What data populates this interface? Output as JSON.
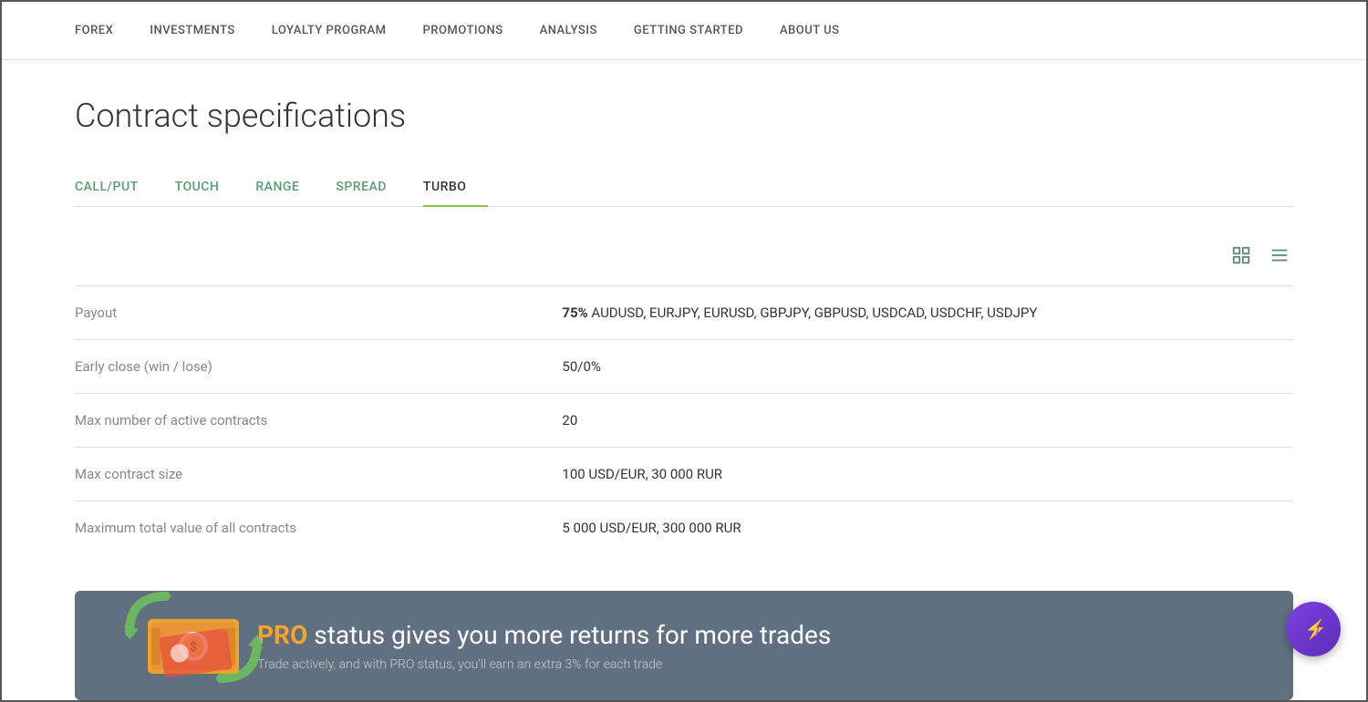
{
  "nav": {
    "items": [
      {
        "label": "FOREX",
        "id": "forex"
      },
      {
        "label": "INVESTMENTS",
        "id": "investments"
      },
      {
        "label": "LOYALTY PROGRAM",
        "id": "loyalty-program"
      },
      {
        "label": "PROMOTIONS",
        "id": "promotions"
      },
      {
        "label": "ANALYSIS",
        "id": "analysis"
      },
      {
        "label": "GETTING STARTED",
        "id": "getting-started"
      },
      {
        "label": "ABOUT US",
        "id": "about-us"
      }
    ]
  },
  "page": {
    "title": "Contract specifications"
  },
  "tabs": [
    {
      "label": "CALL/PUT",
      "id": "call-put",
      "active": false
    },
    {
      "label": "TOUCH",
      "id": "touch",
      "active": false
    },
    {
      "label": "RANGE",
      "id": "range",
      "active": false
    },
    {
      "label": "SPREAD",
      "id": "spread",
      "active": false
    },
    {
      "label": "TURBO",
      "id": "turbo",
      "active": true
    }
  ],
  "specs": [
    {
      "label": "Payout",
      "value": "75% AUDUSD, EURJPY, EURUSD, GBPJPY, GBPUSD, USDCAD, USDCHF, USDJPY",
      "payout_prefix": "75%",
      "payout_suffix": " AUDUSD, EURJPY, EURUSD, GBPJPY, GBPUSD, USDCAD, USDCHF, USDJPY"
    },
    {
      "label": "Early close (win / lose)",
      "value": "50/0%"
    },
    {
      "label": "Max number of active contracts",
      "value": "20"
    },
    {
      "label": "Max contract size",
      "value": "100 USD/EUR, 30 000 RUR"
    },
    {
      "label": "Maximum total value of all contracts",
      "value": "5 000 USD/EUR, 300 000 RUR"
    }
  ],
  "banner": {
    "pro_label": "PRO",
    "title_rest": " status gives you more returns for more trades",
    "subtitle": "Trade actively, and with PRO status, you'll earn an extra 3% for each trade"
  },
  "icons": {
    "grid_view": "⊞",
    "list_view": "☰"
  }
}
